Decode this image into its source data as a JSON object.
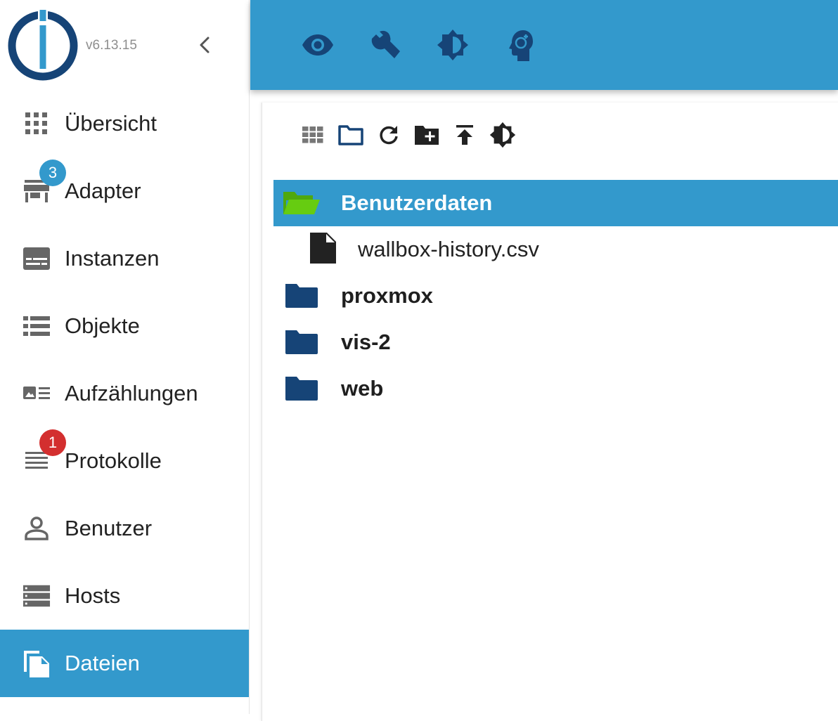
{
  "app": {
    "version": "v6.13.15",
    "colors": {
      "accent": "#3399cc",
      "logo": "#164477",
      "folder": "#164477",
      "folder_open": "#66cc11",
      "badge_blue": "#3399cc",
      "badge_red": "#d32f2f"
    }
  },
  "sidebar": {
    "collapse_icon": "chevron-left-icon",
    "items": [
      {
        "label": "Übersicht",
        "icon": "apps-grid-icon"
      },
      {
        "label": "Adapter",
        "icon": "store-icon",
        "badge": "3"
      },
      {
        "label": "Instanzen",
        "icon": "instances-icon"
      },
      {
        "label": "Objekte",
        "icon": "list-icon"
      },
      {
        "label": "Aufzählungen",
        "icon": "enum-list-icon"
      },
      {
        "label": "Protokolle",
        "icon": "log-lines-icon",
        "badge": "1"
      },
      {
        "label": "Benutzer",
        "icon": "person-icon"
      },
      {
        "label": "Hosts",
        "icon": "server-icon"
      },
      {
        "label": "Dateien",
        "icon": "files-icon",
        "active": true
      }
    ]
  },
  "topbar": {
    "buttons": [
      {
        "icon": "eye-icon"
      },
      {
        "icon": "wrench-icon"
      },
      {
        "icon": "brightness-icon"
      },
      {
        "icon": "expert-mode-icon"
      }
    ]
  },
  "file_browser": {
    "toolbar": [
      {
        "icon": "tile-view-icon"
      },
      {
        "icon": "folder-outline-icon"
      },
      {
        "icon": "refresh-icon"
      },
      {
        "icon": "create-folder-icon"
      },
      {
        "icon": "upload-icon"
      },
      {
        "icon": "brightness-icon"
      }
    ],
    "tree": [
      {
        "label": "Benutzerdaten",
        "type": "folder",
        "open": true,
        "selected": true
      },
      {
        "label": "wallbox-history.csv",
        "type": "file"
      },
      {
        "label": "proxmox",
        "type": "folder"
      },
      {
        "label": "vis-2",
        "type": "folder"
      },
      {
        "label": "web",
        "type": "folder"
      }
    ]
  }
}
